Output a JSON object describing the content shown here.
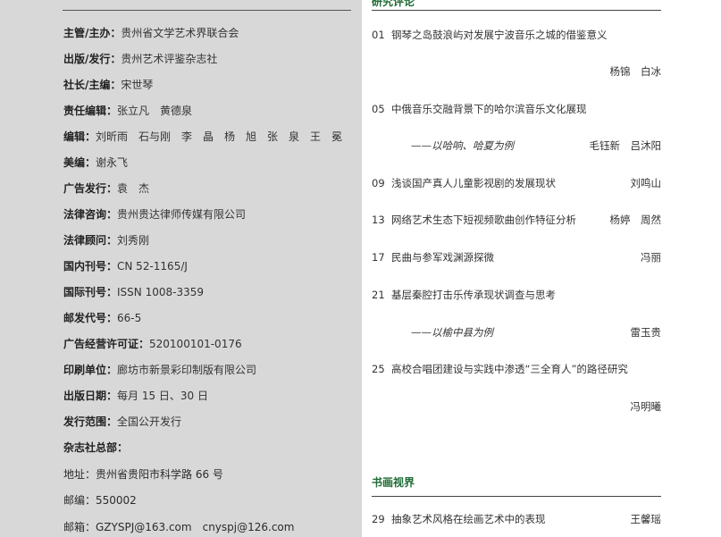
{
  "masthead": {
    "rows": [
      {
        "label": "主管/主办：",
        "value": "贵州省文学艺术界联合会"
      },
      {
        "label": "出版/发行：",
        "value": "贵州艺术评鉴杂志社"
      },
      {
        "label": "社长/主编：",
        "value": "宋世琴"
      },
      {
        "label": "责任编辑：",
        "value": "张立凡　黄德泉"
      },
      {
        "label": "编辑：",
        "value": "刘昕雨　石与刚　李　晶　杨　旭　张　泉　王　冕"
      },
      {
        "label": "美编：",
        "value": "谢永飞"
      },
      {
        "label": "广告发行：",
        "value": "袁　杰"
      },
      {
        "label": "法律咨询：",
        "value": "贵州贵达律师传媒有限公司"
      },
      {
        "label": "法律顾问：",
        "value": "刘秀刚"
      },
      {
        "label": "国内刊号：",
        "value": "CN 52-1165/J"
      },
      {
        "label": "国际刊号：",
        "value": "ISSN 1008-3359"
      },
      {
        "label": "邮发代号：",
        "value": "66-5"
      },
      {
        "label": "广告经营许可证：",
        "value": "520100101-0176"
      },
      {
        "label": "印刷单位：",
        "value": "廊坊市新景彩印制版有限公司"
      },
      {
        "label": "出版日期：",
        "value": "每月 15 日、30 日"
      },
      {
        "label": "发行范围：",
        "value": "全国公开发行"
      },
      {
        "label": "杂志社总部：",
        "value": ""
      }
    ],
    "address_lines": [
      "地址：贵州省贵阳市科学路 66 号",
      "邮编：550002",
      "邮箱：GZYSPJ@163.com　cnyspj@126.com"
    ]
  },
  "contents": {
    "section1_heading": "研究评论",
    "entries": [
      {
        "num": "01",
        "title": "钢琴之岛鼓浪屿对发展宁波音乐之城的借鉴意义",
        "author": ""
      },
      {
        "num": "",
        "title": "",
        "author": "杨锦　白冰"
      },
      {
        "num": "05",
        "title": "中俄音乐交融背景下的哈尔滨音乐文化展现",
        "author": ""
      },
      {
        "num": "",
        "sub": "——以哈响、哈夏为例",
        "author": "毛钰新　吕沐阳"
      },
      {
        "num": "09",
        "title": "浅谈国产真人儿童影视剧的发展现状",
        "author": "刘鸣山"
      },
      {
        "num": "13",
        "title": "网络艺术生态下短视频歌曲创作特征分析",
        "author": "杨婷　周然"
      },
      {
        "num": "17",
        "title": "民曲与参军戏渊源探微",
        "author": "冯丽"
      },
      {
        "num": "21",
        "title": "基层秦腔打击乐传承现状调查与思考",
        "author": ""
      },
      {
        "num": "",
        "sub": "——以榆中县为例",
        "author": "雷玉贵"
      },
      {
        "num": "25",
        "title": "高校合唱团建设与实践中渗透“三全育人”的路径研究",
        "author": ""
      },
      {
        "num": "",
        "title": "",
        "author": "冯明曦"
      }
    ],
    "section2_heading": "书画视界",
    "entries2": [
      {
        "num": "29",
        "title": "抽象艺术风格在绘画艺术中的表现",
        "author": "王馨瑶"
      }
    ]
  }
}
